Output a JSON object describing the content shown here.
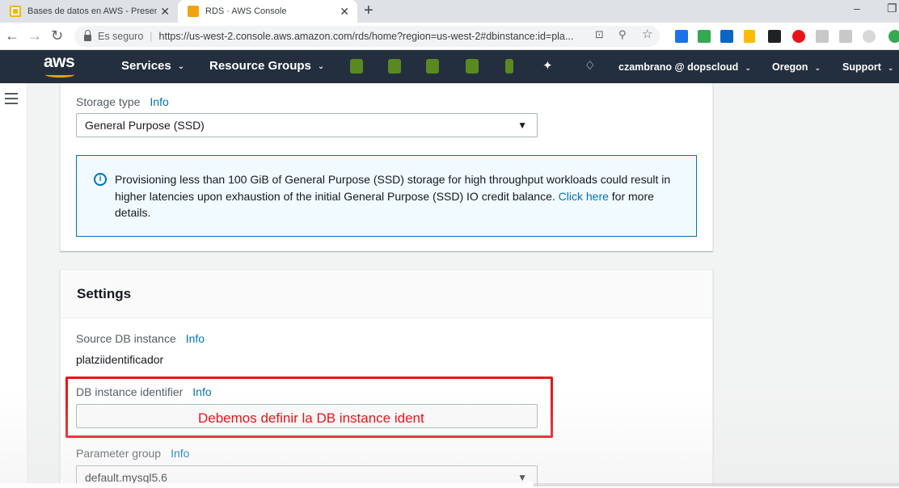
{
  "browser": {
    "tabs": [
      {
        "title": "Bases de datos en AWS - Presentación",
        "favicon": "slides-icon"
      },
      {
        "title": "RDS · AWS Console",
        "favicon": "aws-icon"
      }
    ],
    "close_glyph": "✕",
    "new_tab_glyph": "+",
    "minimize_glyph": "–",
    "restore_glyph": "❐",
    "back_glyph": "←",
    "forward_glyph": "→",
    "reload_glyph": "↻",
    "secure_label": "Es seguro",
    "url": "https://us-west-2.console.aws.amazon.com/rds/home?region=us-west-2#dbinstance:id=pla...",
    "translate_glyph": "⊡",
    "zoom_glyph": "⚲",
    "bookmark_glyph": "☆"
  },
  "aws_header": {
    "logo": "aws",
    "services": "Services",
    "resource_groups": "Resource Groups",
    "caret": "⌄",
    "pin_glyph": "✦",
    "bell_glyph": "♢",
    "account": "czambrano @ dopscloud",
    "region": "Oregon",
    "support": "Support"
  },
  "storage": {
    "label": "Storage type",
    "info": "Info",
    "selected": "General Purpose (SSD)",
    "arrow": "▼",
    "alert_icon": "i",
    "alert_text": "Provisioning less than 100 GiB of General Purpose (SSD) storage for high throughput workloads could result in higher latencies upon exhaustion of the initial General Purpose (SSD) IO credit balance.",
    "alert_link": "Click here",
    "alert_tail": "for more details."
  },
  "settings": {
    "title": "Settings",
    "source_label": "Source DB instance",
    "source_info": "Info",
    "source_value": "platziidentificador",
    "identifier_label": "DB instance identifier",
    "identifier_info": "Info",
    "identifier_value": "",
    "param_label": "Parameter group",
    "param_info": "Info",
    "param_value": "default.mysql5.6"
  },
  "overlay": {
    "caption": "Debemos definir la DB instance ident",
    "highlight_color": "#e8141a"
  },
  "video": {
    "progress_fraction": 0.59
  }
}
